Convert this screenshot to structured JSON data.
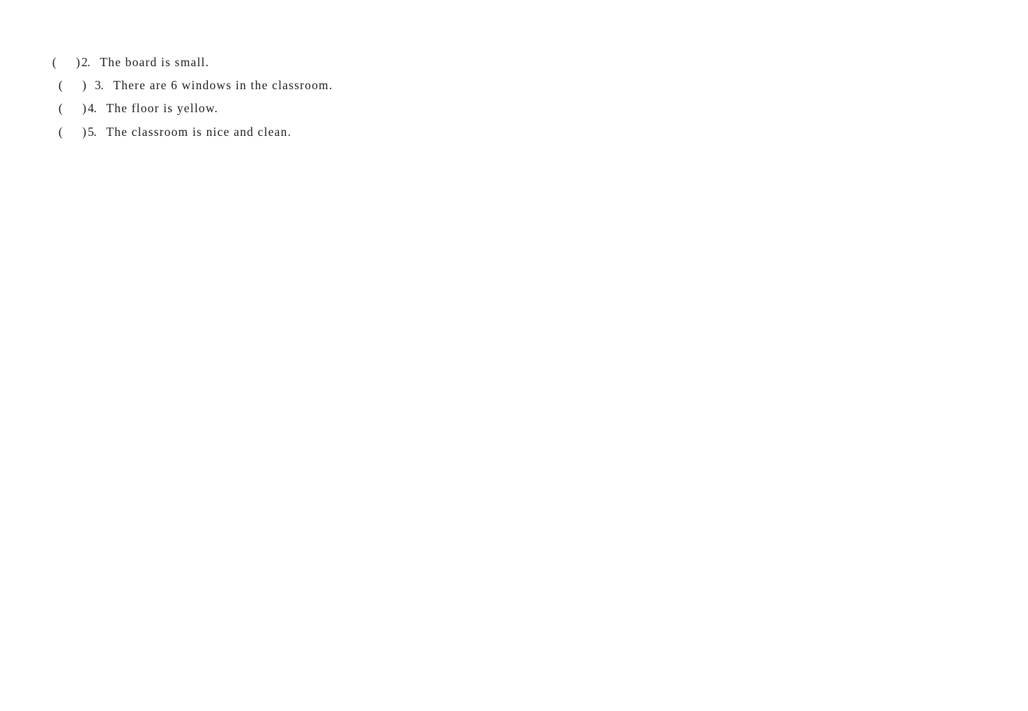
{
  "questions": [
    {
      "open": "(",
      "close": ")",
      "number": "2.",
      "text": "The board is small."
    },
    {
      "open": "(",
      "close": ")",
      "number": "3.",
      "text": "There are 6 windows in the classroom."
    },
    {
      "open": "(",
      "close": ")",
      "number": "4.",
      "text": "The floor is yellow."
    },
    {
      "open": "(",
      "close": ")",
      "number": "5.",
      "text": "The classroom is nice and clean."
    }
  ]
}
